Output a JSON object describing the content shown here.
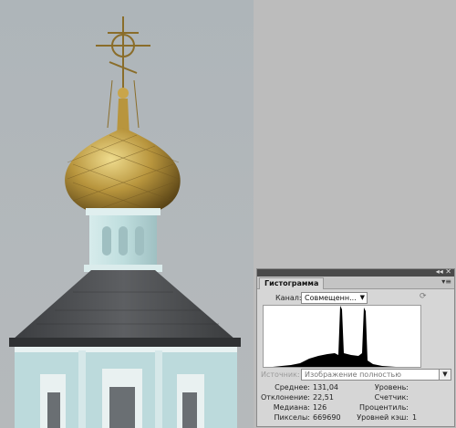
{
  "panel": {
    "tab_title": "Гистограмма",
    "channel_label": "Канал:",
    "channel_value": "Совмещенн...",
    "source_label": "Источник:",
    "source_value": "Изображение полностью"
  },
  "stats_left": [
    {
      "label": "Среднее:",
      "value": "131,04"
    },
    {
      "label": "Отклонение:",
      "value": "22,51"
    },
    {
      "label": "Медиана:",
      "value": "126"
    },
    {
      "label": "Пикселы:",
      "value": "669690"
    }
  ],
  "stats_right": [
    {
      "label": "Уровень:",
      "value": ""
    },
    {
      "label": "Счетчик:",
      "value": ""
    },
    {
      "label": "Процентиль:",
      "value": ""
    },
    {
      "label": "Уровней кэш:",
      "value": "1"
    }
  ],
  "colors": {
    "sky": "#b3b8bb",
    "dome_gold": "#b8953d",
    "roof": "#4a4c4f",
    "drum": "#bfdede"
  }
}
